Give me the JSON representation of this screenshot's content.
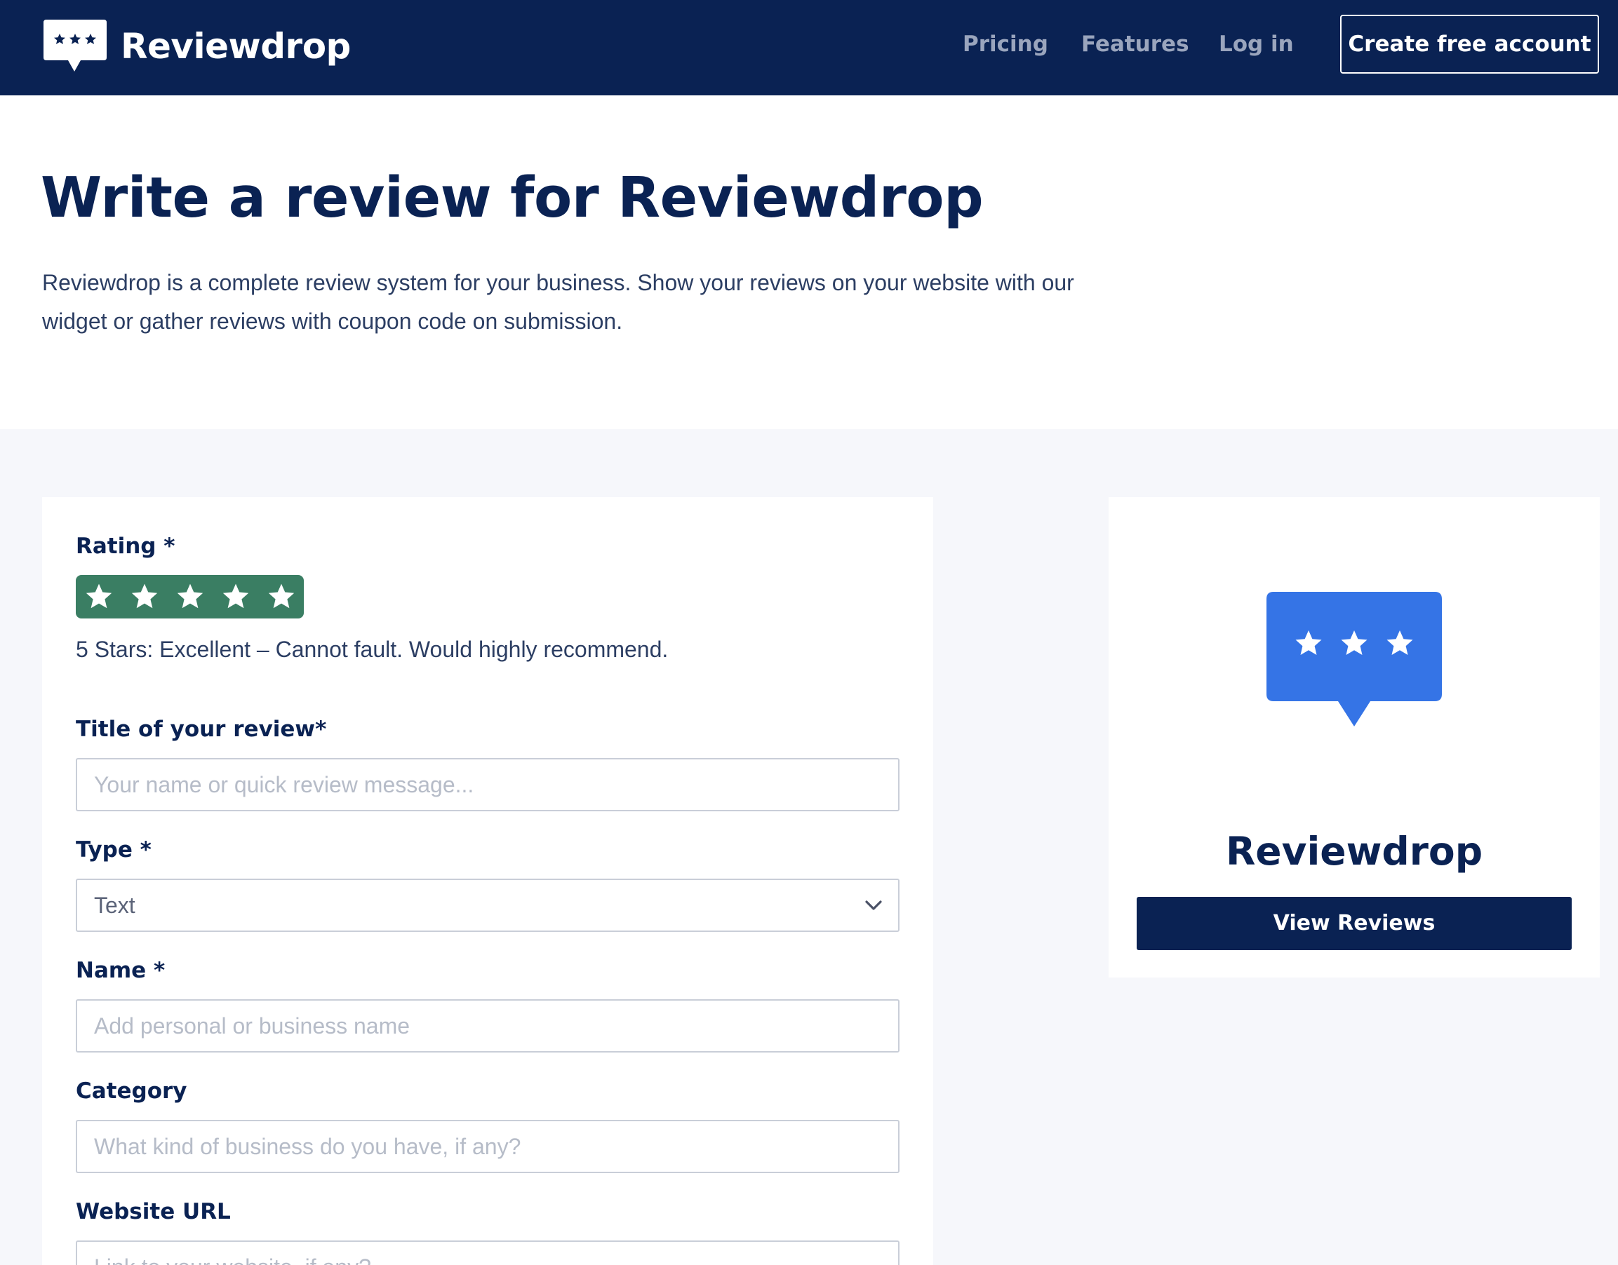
{
  "nav": {
    "brand": "Reviewdrop",
    "links": [
      "Pricing",
      "Features",
      "Log in"
    ],
    "cta": "Create free account"
  },
  "hero": {
    "title": "Write a review for Reviewdrop",
    "description": "Reviewdrop is a complete review system for your business. Show your reviews on your website with our widget or gather reviews with coupon code on submission."
  },
  "form": {
    "rating": {
      "label": "Rating *",
      "value": 5,
      "max": 5,
      "text": "5 Stars: Excellent – Cannot fault. Would highly recommend.",
      "color": "#3a7e63"
    },
    "title_field": {
      "label": "Title of your review*",
      "placeholder": "Your name or quick review message..."
    },
    "type_field": {
      "label": "Type *",
      "value": "Text"
    },
    "name_field": {
      "label": "Name *",
      "placeholder": "Add personal or business name"
    },
    "category_field": {
      "label": "Category",
      "placeholder": "What kind of business do you have, if any?"
    },
    "website_field": {
      "label": "Website URL",
      "placeholder": "Link to your website, if any?"
    }
  },
  "side": {
    "name": "Reviewdrop",
    "button": "View Reviews",
    "logo_color": "#3574e6"
  },
  "colors": {
    "navy": "#0a2253",
    "accent_green": "#3a7e63",
    "accent_blue": "#3574e6"
  }
}
